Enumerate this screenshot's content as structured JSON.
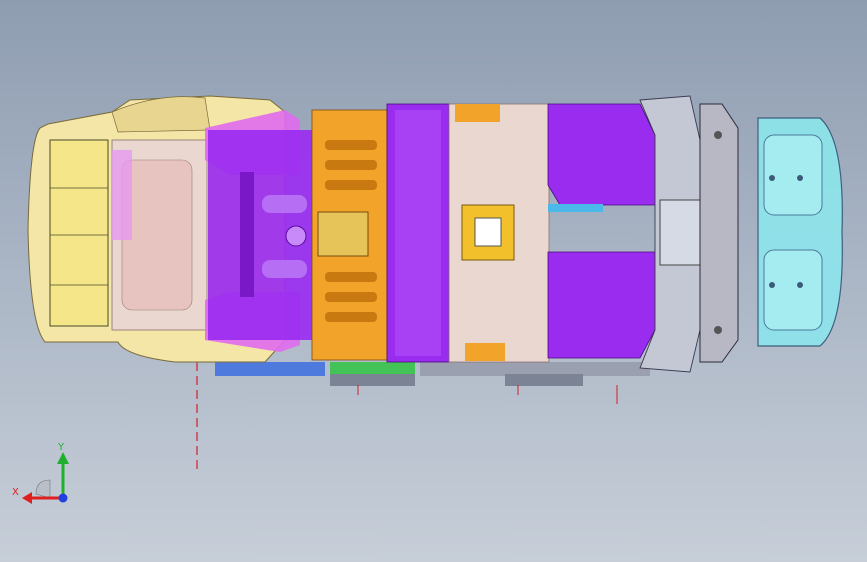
{
  "viewport": {
    "background_top": "#8f9db1",
    "background_bottom": "#c7ced8"
  },
  "model": {
    "view": "top",
    "colors": {
      "cab_cream": "#f3e6a6",
      "cab_edge": "#e8d590",
      "magenta": "#e06cf0",
      "purple": "#9a2cf0",
      "orange": "#f2a42a",
      "pink_panel": "#d9a6c8",
      "interior_beige": "#ead7cf",
      "steel_grey": "#b8b8c4",
      "cyan_cover": "#8ee3ea",
      "blue_frame": "#3c6fe0",
      "green_part": "#36c24a",
      "centerline": "#d2202a"
    }
  },
  "triad": {
    "x_label": "X",
    "y_label": "Y",
    "x_color": "#e02020",
    "y_color": "#20b030",
    "z_color": "#2040e0"
  }
}
